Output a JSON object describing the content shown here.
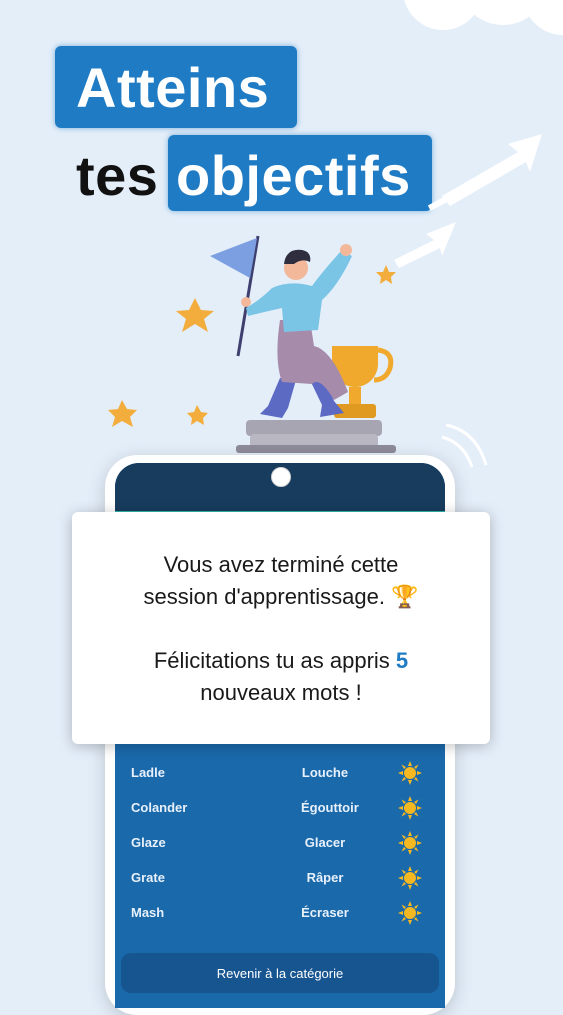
{
  "headline": {
    "line1": "Atteins",
    "line2_word1": "tes",
    "line2_word2": "objectifs"
  },
  "card": {
    "line1": "Vous avez terminé cette",
    "line2": "session d'apprentissage. 🏆",
    "line3": "Félicitations tu as appris ",
    "count": "5",
    "line4": "nouveaux mots !"
  },
  "words": [
    {
      "en": "Ladle",
      "fr": "Louche"
    },
    {
      "en": "Colander",
      "fr": "Égouttoir"
    },
    {
      "en": "Glaze",
      "fr": "Glacer"
    },
    {
      "en": "Grate",
      "fr": "Râper"
    },
    {
      "en": "Mash",
      "fr": "Écraser"
    }
  ],
  "back_button": "Revenir à la catégorie",
  "colors": {
    "accent": "#1f7cc4",
    "screen": "#1a69ab",
    "screen_header": "#173c5e",
    "background": "#e4eef9"
  }
}
